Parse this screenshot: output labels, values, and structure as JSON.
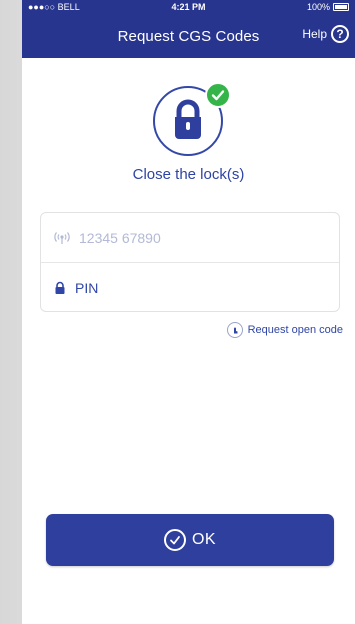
{
  "status_bar": {
    "carrier": "●●●○○ BELL",
    "time": "4:21 PM",
    "battery": "100%"
  },
  "navbar": {
    "title": "Request CGS Codes",
    "help_label": "Help",
    "help_icon_glyph": "?"
  },
  "status_message": "Close the lock(s)",
  "form": {
    "lock_id_value": "12345  67890",
    "pin_placeholder": "PIN"
  },
  "request_open_code_label": "Request open code",
  "ok_button": {
    "label": "OK"
  },
  "colors": {
    "primary": "#27358f",
    "accent_text": "#2e43a3",
    "success": "#35b44a",
    "muted": "#b3b9d6"
  },
  "icons": {
    "lock": "lock-icon",
    "check": "check-icon",
    "signal": "signal-icon",
    "padlock": "padlock-icon",
    "hand_tap": "hand-tap-icon",
    "ok_check": "check-circle-icon",
    "help": "help-icon"
  }
}
